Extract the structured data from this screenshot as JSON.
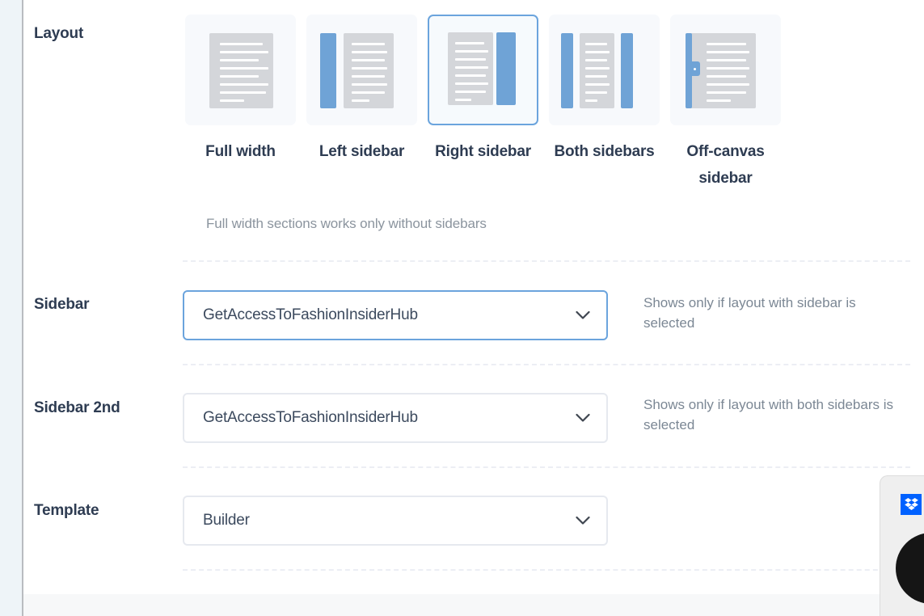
{
  "page": {
    "background_color": "#ffffff",
    "rail_color": "#eef4f8",
    "accent_color": "#6ba4dd",
    "label_color": "#2e3c52",
    "help_text_color": "#7b8794"
  },
  "layout_row": {
    "label": "Layout",
    "note": "Full width sections works only without sidebars",
    "options": [
      {
        "id": "full-width",
        "label": "Full width",
        "selected": false
      },
      {
        "id": "left-sidebar",
        "label": "Left sidebar",
        "selected": false
      },
      {
        "id": "right-sidebar",
        "label": "Right sidebar",
        "selected": true
      },
      {
        "id": "both-sidebars",
        "label": "Both sidebars",
        "selected": false
      },
      {
        "id": "off-canvas",
        "label": "Off-canvas sidebar",
        "selected": false
      }
    ]
  },
  "sidebar_row": {
    "label": "Sidebar",
    "value": "GetAccessToFashionInsiderHub",
    "help": "Shows only if layout with sidebar is selected",
    "focused": true
  },
  "sidebar2_row": {
    "label": "Sidebar 2nd",
    "value": "GetAccessToFashionInsiderHub",
    "help": "Shows only if layout with both sidebars is selected",
    "focused": false
  },
  "template_row": {
    "label": "Template",
    "value": "Builder",
    "help": "",
    "focused": false
  },
  "widget": {
    "dropbox_icon": "dropbox-icon",
    "badge": "black-circle-badge",
    "brand_color": "#0061ff"
  }
}
